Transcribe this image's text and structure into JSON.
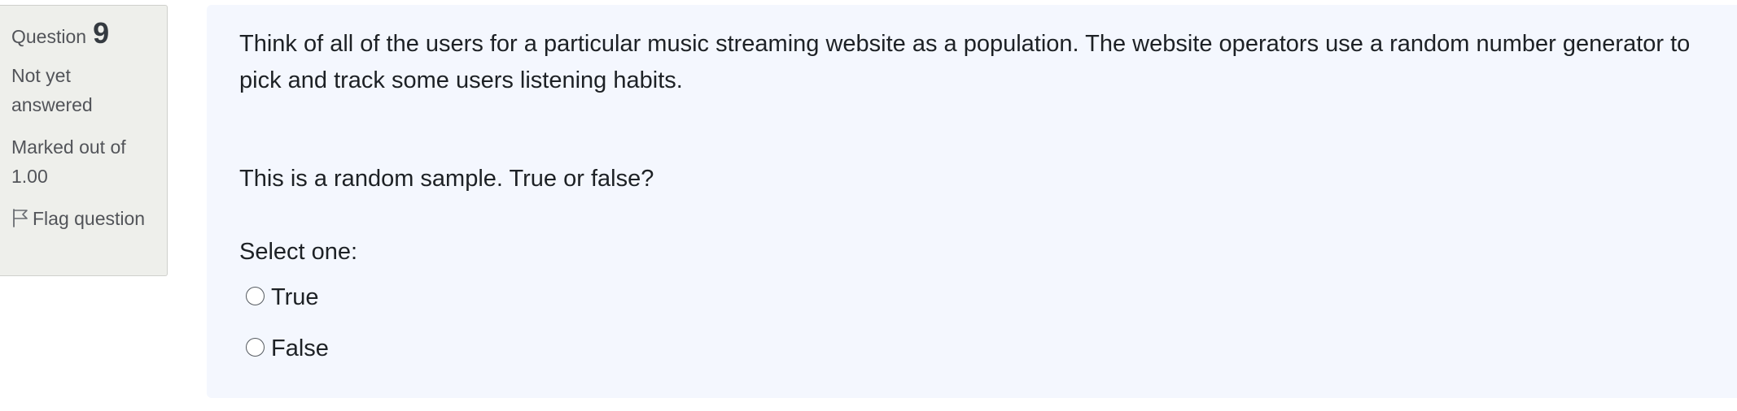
{
  "info": {
    "question_label": "Question",
    "question_number": "9",
    "state": "Not yet answered",
    "grade": "Marked out of 1.00",
    "flag_label": "Flag question",
    "flag_icon": "flag-outline-icon"
  },
  "question": {
    "text_paragraph_1": "Think of all of the users for a particular music streaming website as a population. The website operators use a random number generator to pick and track some users listening habits.",
    "text_paragraph_2": "This is a random sample. True or false?",
    "prompt": "Select one:",
    "options": [
      {
        "label": "True",
        "selected": false
      },
      {
        "label": "False",
        "selected": false
      }
    ]
  },
  "colors": {
    "info_background": "#eeefeb",
    "content_background": "#f4f7fe",
    "text": "#1d2125",
    "muted_text": "#525459"
  }
}
